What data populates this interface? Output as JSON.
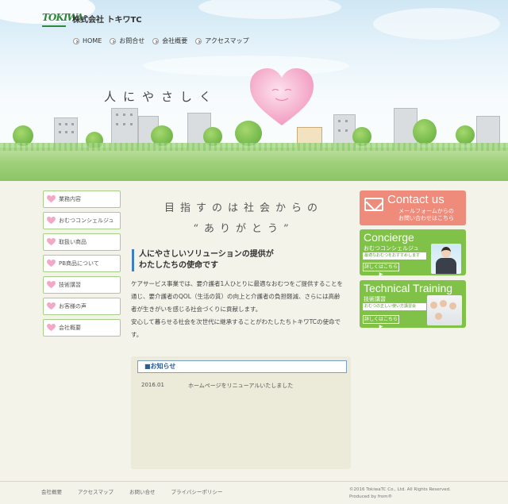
{
  "header": {
    "logo_mark": "TOKIWA",
    "company": "株式会社 トキワTC",
    "nav": [
      "HOME",
      "お問合せ",
      "会社概要",
      "アクセスマップ"
    ]
  },
  "hero": {
    "tagline": "人にやさしく"
  },
  "sidebar": {
    "items": [
      "業務内容",
      "おむつコンシェルジュ",
      "取扱い商品",
      "PB商品について",
      "技術講習",
      "お客様の声",
      "会社概要"
    ]
  },
  "main": {
    "heading_line1": "目指すのは社会からの",
    "heading_line2": "“ありがとう”",
    "solution_line1": "人にやさしいソリューションの提供が",
    "solution_line2": "わたしたちの使命です",
    "body": [
      "ケアサービス事業では、要介護者1人ひとりに最適なおむつをご提供することを",
      "通じ、要介護者のQOL（生活の質）の向上と介護者の負担軽減、さらには高齢",
      "者が生きがいを感じる社会づくりに貢献します。",
      "安心して暮らせる社会を次世代に継承することがわたしたちトキワTCの使命で",
      "す。"
    ]
  },
  "news": {
    "title": "■お知らせ",
    "items": [
      {
        "date": "2016.01",
        "text": "ホームページをリニューアルいたしました"
      }
    ]
  },
  "banners": {
    "contact": {
      "title": "Contact us",
      "line1": "メールフォームからの",
      "line2": "お問い合わせはこちら"
    },
    "concierge": {
      "title": "Concierge",
      "subtitle": "おむつコンシェルジュ",
      "desc": "最適なおむつをおすすめします",
      "more": "詳しくはこちら ▶"
    },
    "technical": {
      "title": "Technical Training",
      "subtitle": "技術講習",
      "desc": "おむつの正しい使い方講習会",
      "more": "詳しくはこちら ▶"
    }
  },
  "footer": {
    "links": [
      "会社概要",
      "アクセスマップ",
      "お問い合せ",
      "プライバシーポリシー"
    ],
    "copyright": "©2016 TokiwaTC Co., Ltd. All Rights Reserved.",
    "produced": "Produced by from®"
  },
  "colors": {
    "accent_green": "#7fc247",
    "contact_coral": "#ee8b7a",
    "heart_pink": "#f4a8c8",
    "news_blue": "#2a5c96"
  }
}
